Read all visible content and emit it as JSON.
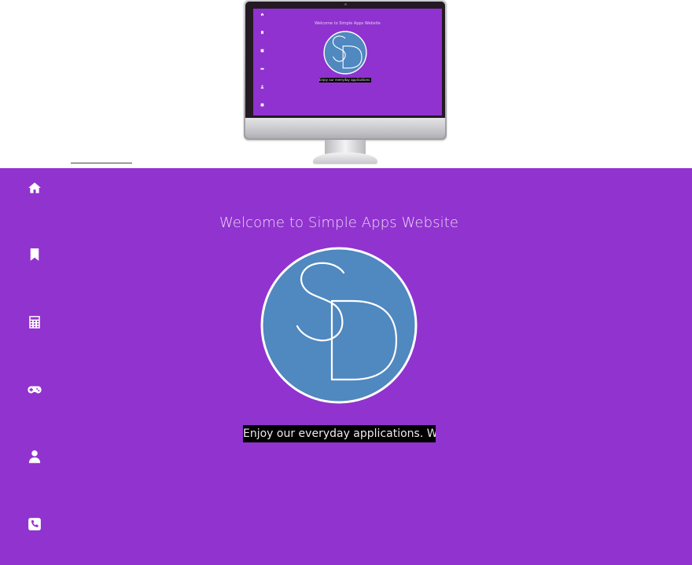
{
  "site": {
    "welcome_title": "Welcome to Simple Apps Website",
    "tagline": "Enjoy our everyday applications. We m",
    "logo_monogram": "SD"
  },
  "nav": [
    {
      "name": "nav-home",
      "icon": "home-icon"
    },
    {
      "name": "nav-bookmark",
      "icon": "bookmark-icon"
    },
    {
      "name": "nav-calculator",
      "icon": "calculator-icon"
    },
    {
      "name": "nav-games",
      "icon": "gamepad-icon"
    },
    {
      "name": "nav-profile",
      "icon": "user-icon"
    },
    {
      "name": "nav-contact",
      "icon": "phone-icon"
    }
  ],
  "mockup": {
    "title": "Welcome to Simple Apps Website",
    "tagline": "Enjoy our everyday applications. We m"
  },
  "colors": {
    "background": "#9133cf",
    "logo_fill": "#5088c0",
    "logo_ring": "#ffffff",
    "tagline_bg": "#000000"
  }
}
